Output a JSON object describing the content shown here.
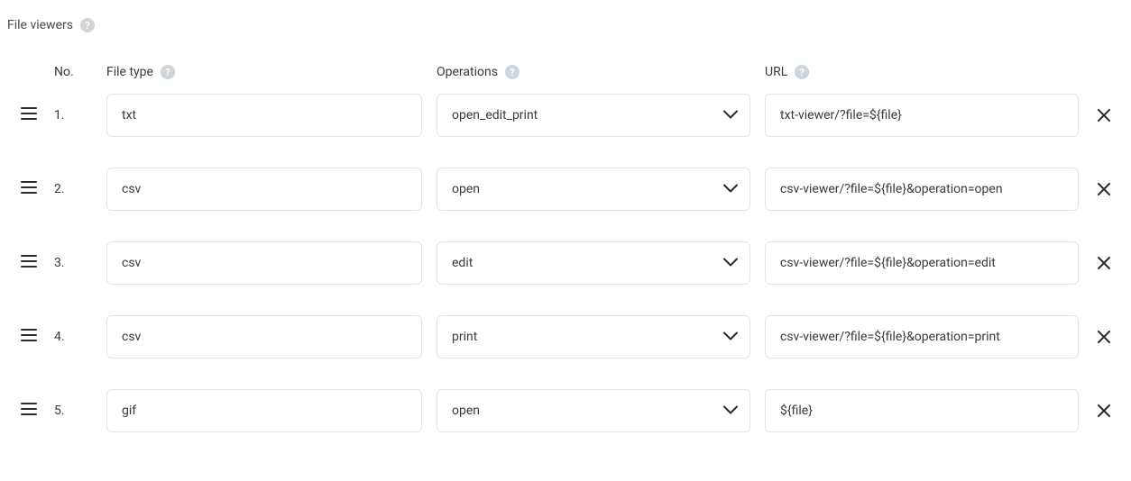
{
  "section": {
    "title": "File viewers"
  },
  "columns": {
    "no": "No.",
    "file_type": "File type",
    "operations": "Operations",
    "url": "URL"
  },
  "rows": [
    {
      "no": "1.",
      "file_type": "txt",
      "operation": "open_edit_print",
      "url": "txt-viewer/?file=${file}"
    },
    {
      "no": "2.",
      "file_type": "csv",
      "operation": "open",
      "url": "csv-viewer/?file=${file}&operation=open"
    },
    {
      "no": "3.",
      "file_type": "csv",
      "operation": "edit",
      "url": "csv-viewer/?file=${file}&operation=edit"
    },
    {
      "no": "4.",
      "file_type": "csv",
      "operation": "print",
      "url": "csv-viewer/?file=${file}&operation=print"
    },
    {
      "no": "5.",
      "file_type": "gif",
      "operation": "open",
      "url": "${file}"
    }
  ]
}
